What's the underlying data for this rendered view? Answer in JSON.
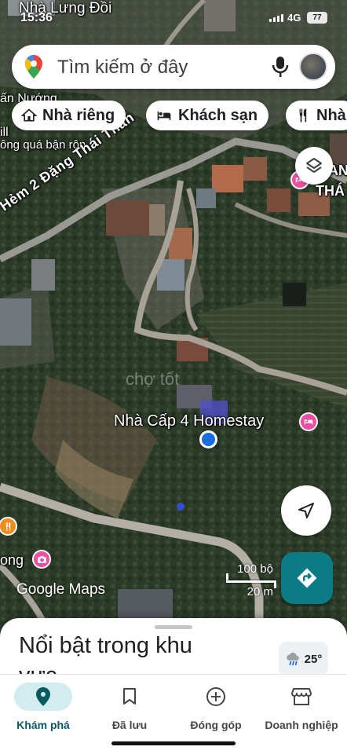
{
  "status_bar": {
    "time": "15:36",
    "network": "4G",
    "battery": "77"
  },
  "search": {
    "placeholder": "Tìm kiếm ở đây"
  },
  "chips": [
    {
      "label": "Nhà riêng",
      "icon": "home-icon"
    },
    {
      "label": "Khách sạn",
      "icon": "bed-icon"
    },
    {
      "label": "Nhà",
      "icon": "restaurant-icon"
    }
  ],
  "map": {
    "labels": {
      "top_place": "Nhà Lưng Đồi",
      "top_left_place_1": "ấn Nướng",
      "top_left_place_2": "ill",
      "business_hint": "ông quá bận rộn",
      "street": "Hẻm 2 Đặng Thái Thân",
      "right_place_1": "AN",
      "right_place_2": "THÁ",
      "homestay": "Nhà Cấp 4 Homestay",
      "bottom_place": "ong",
      "watermark": "chợ tốt"
    },
    "scale": {
      "top": "100 bộ",
      "bottom": "20 m"
    },
    "attribution": "Google Maps"
  },
  "sheet": {
    "title": "Nổi bật trong khu vực",
    "weather": {
      "temp": "25°",
      "icon": "cloud-rain-icon"
    }
  },
  "nav": [
    {
      "label": "Khám phá",
      "icon": "explore-pin-icon",
      "active": true
    },
    {
      "label": "Đã lưu",
      "icon": "bookmark-icon",
      "active": false
    },
    {
      "label": "Đóng góp",
      "icon": "add-circle-icon",
      "active": false
    },
    {
      "label": "Doanh nghiệp",
      "icon": "storefront-icon",
      "active": false
    }
  ],
  "colors": {
    "accent": "#0b7c86",
    "poi_pink": "#ec4fa0",
    "location_blue": "#1a6dde",
    "nav_active_bg": "#d2ecef"
  }
}
